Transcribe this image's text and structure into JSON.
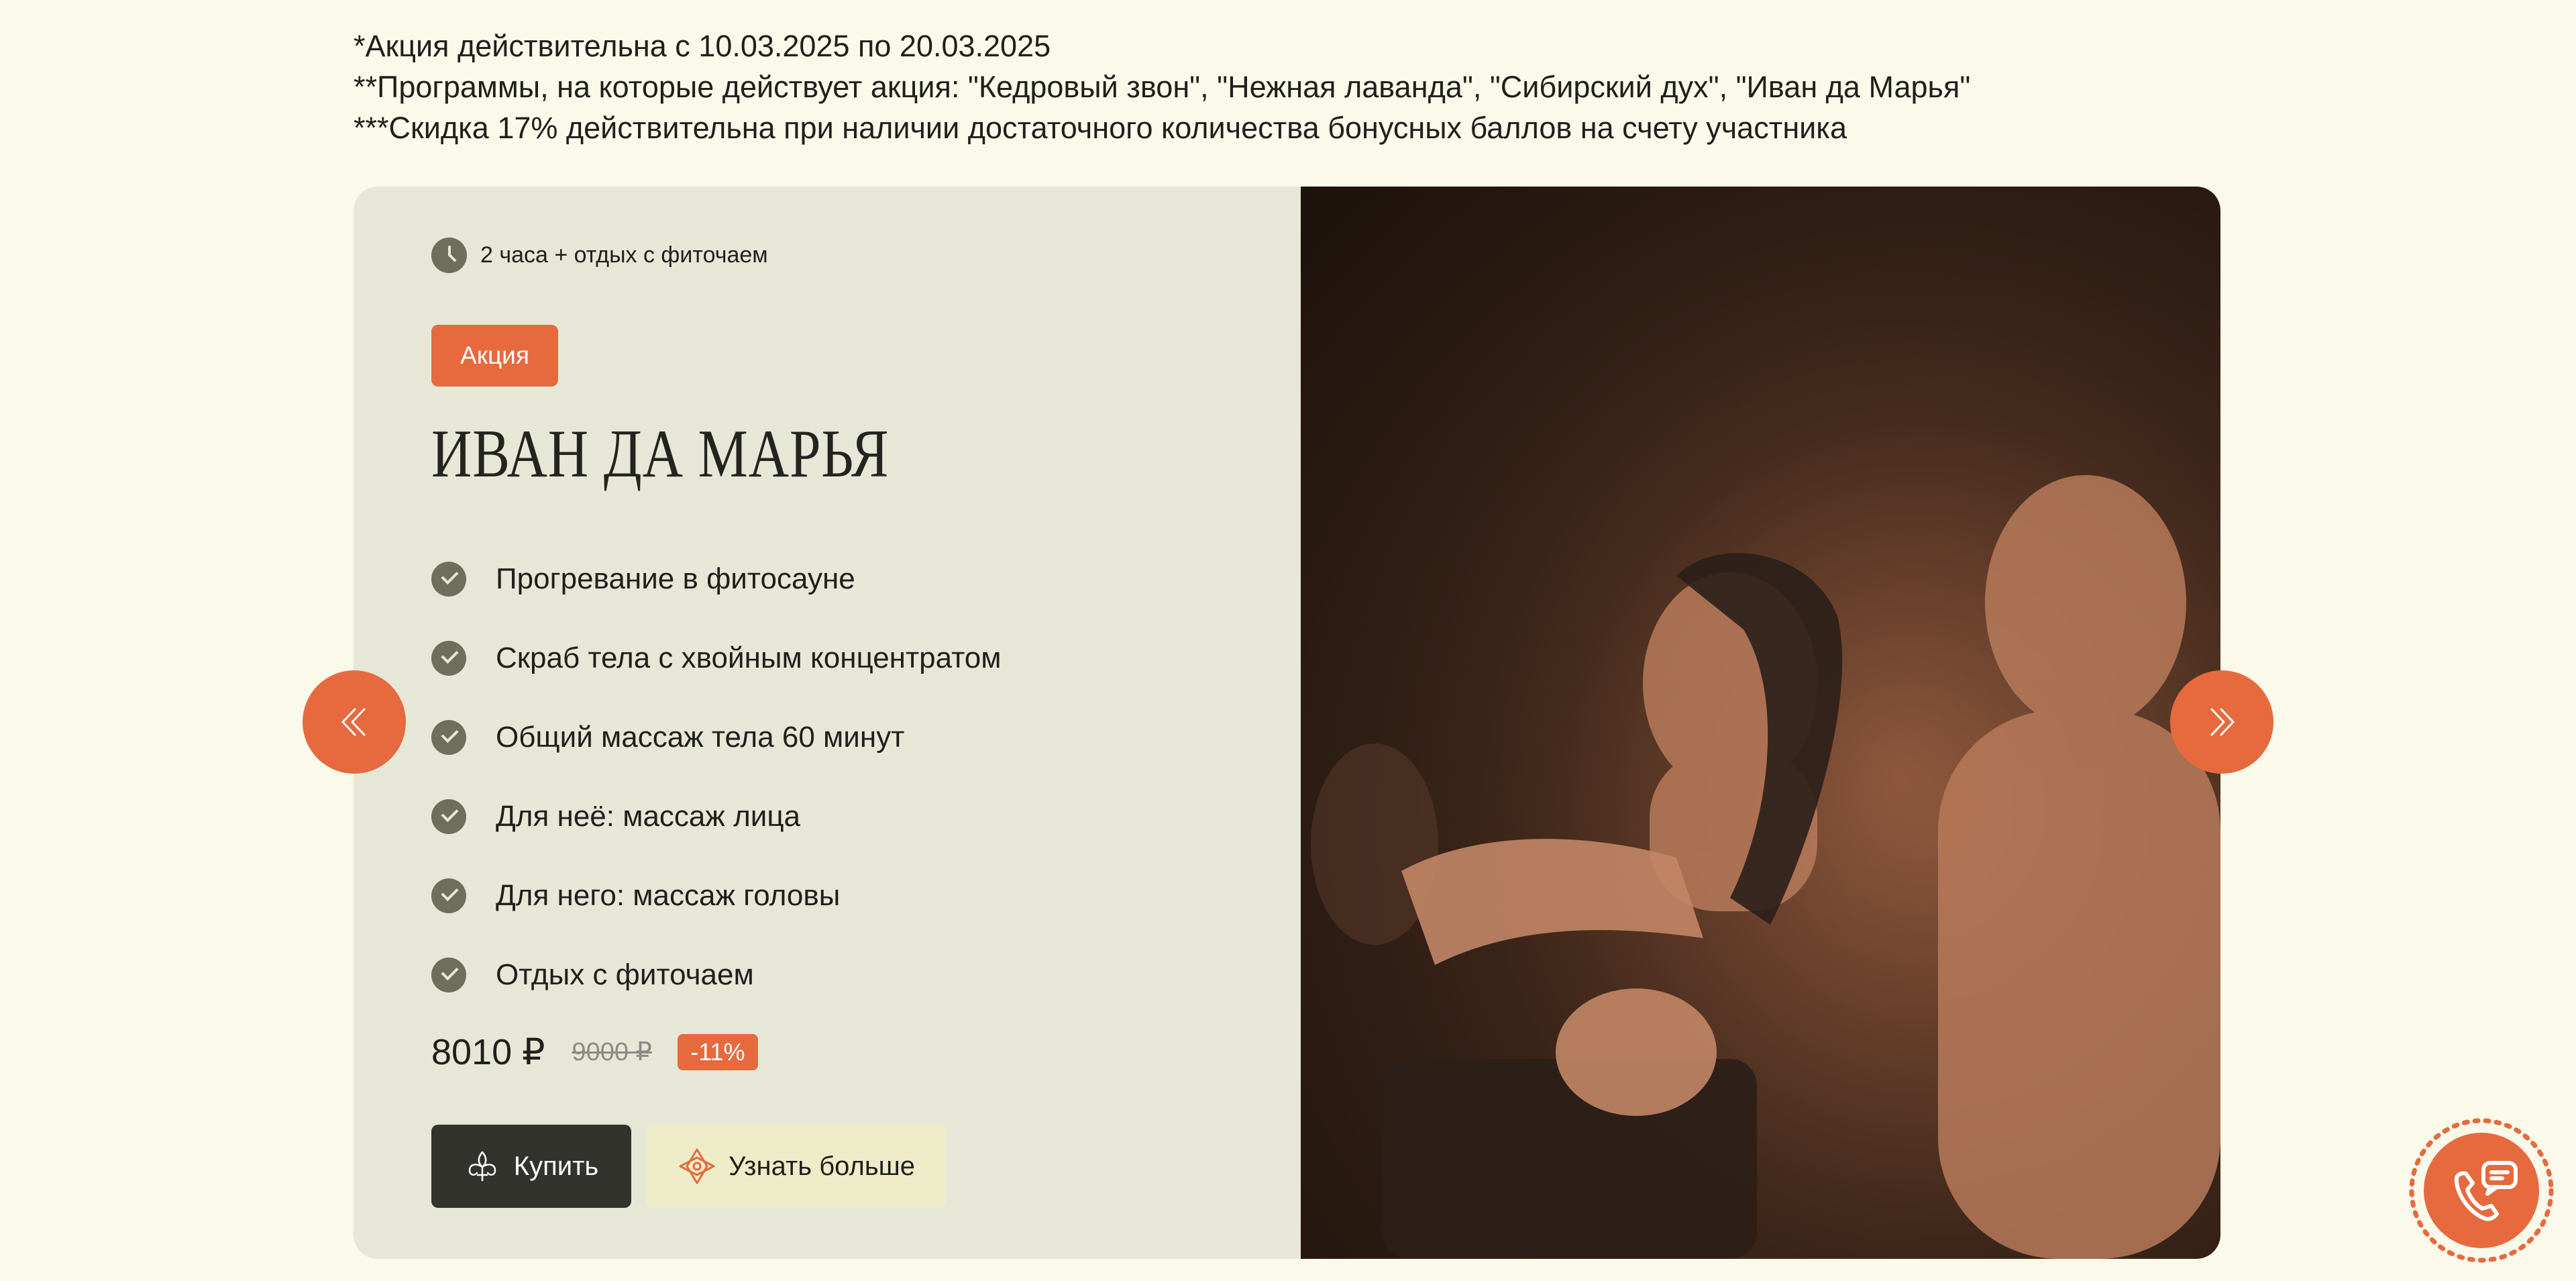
{
  "promo_notes": [
    "*Акция действительна с 10.03.2025 по 20.03.2025",
    "**Программы, на которые действует акция: \"Кедровый звон\", \"Нежная лаванда\", \"Сибирский дух\", \"Иван да Марья\"",
    "***Скидка 17% действительна при наличии достаточного количества бонусных баллов на счету участника"
  ],
  "card": {
    "duration": "2 часа + отдых с фиточаем",
    "badge": "Акция",
    "title": "ИВАН ДА МАРЬЯ",
    "features": [
      "Прогревание в фитосауне",
      "Скраб тела с хвойным концентратом",
      "Общий массаж тела 60 минут",
      "Для неё: массаж лица",
      "Для него: массаж головы",
      "Отдых с фиточаем"
    ],
    "price": "8010 ₽",
    "old_price": "9000 ₽",
    "discount": "-11%",
    "buy_label": "Купить",
    "more_label": "Узнать больше"
  },
  "colors": {
    "accent": "#e66a3e",
    "page_background": "#faf9ea",
    "card_background": "#e7e7d8",
    "dark_button": "#33332e",
    "light_button": "#eeecc8",
    "icon_gray": "#6e6e5c"
  },
  "icons": {
    "duration": "clock-icon",
    "feature": "check-circle-icon",
    "buy": "fleur-de-lis-icon",
    "more": "compass-ornament-icon",
    "prev": "double-chevron-left-icon",
    "next": "double-chevron-right-icon",
    "contact": "phone-chat-icon"
  }
}
